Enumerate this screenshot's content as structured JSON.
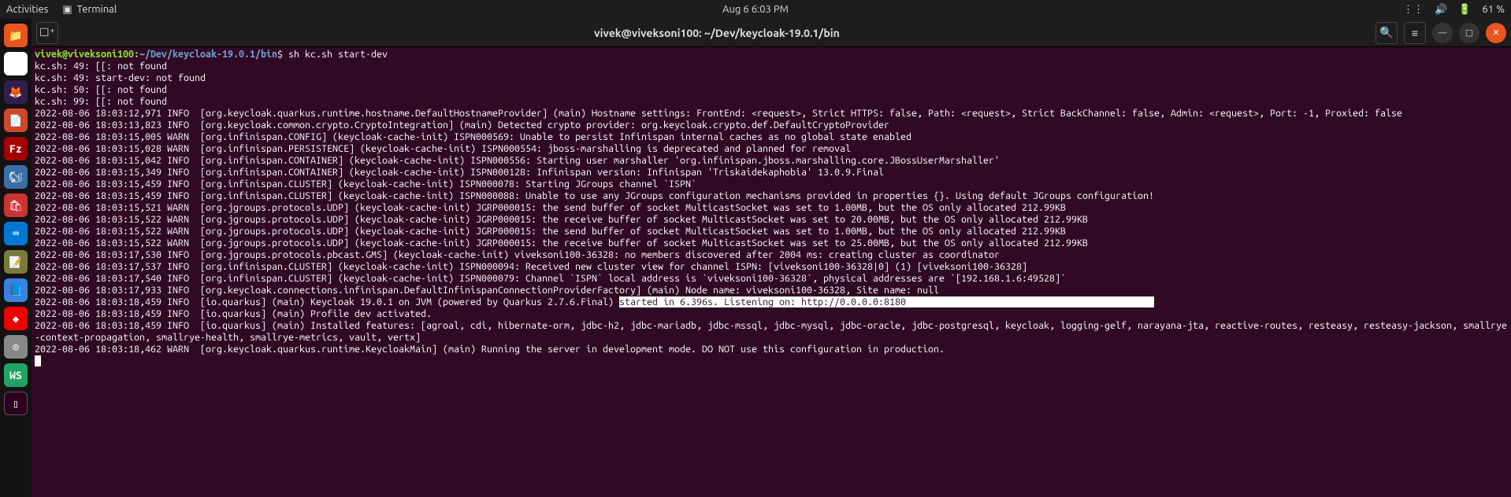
{
  "topbar": {
    "activities": "Activities",
    "app_label": "Terminal",
    "clock": "Aug 6  6:03 PM",
    "battery": "61 %"
  },
  "titlebar": {
    "title": "vivek@viveksoni100: ~/Dev/keycloak-19.0.1/bin"
  },
  "prompt": {
    "user_host": "vivek@viveksoni100:",
    "path": "~/Dev/keycloak-19.0.1/bin",
    "dollar": "$",
    "command": " sh kc.sh start-dev"
  },
  "lines": {
    "l0": "kc.sh: 49: [[: not found",
    "l1": "kc.sh: 49: start-dev: not found",
    "l2": "kc.sh: 50: [[: not found",
    "l3": "kc.sh: 99: [[: not found",
    "l4": "2022-08-06 18:03:12,971 INFO  [org.keycloak.quarkus.runtime.hostname.DefaultHostnameProvider] (main) Hostname settings: FrontEnd: <request>, Strict HTTPS: false, Path: <request>, Strict BackChannel: false, Admin: <request>, Port: -1, Proxied: false",
    "l5": "2022-08-06 18:03:13,823 INFO  [org.keycloak.common.crypto.CryptoIntegration] (main) Detected crypto provider: org.keycloak.crypto.def.DefaultCryptoProvider",
    "l6": "2022-08-06 18:03:15,005 WARN  [org.infinispan.CONFIG] (keycloak-cache-init) ISPN000569: Unable to persist Infinispan internal caches as no global state enabled",
    "l7": "2022-08-06 18:03:15,028 WARN  [org.infinispan.PERSISTENCE] (keycloak-cache-init) ISPN000554: jboss-marshalling is deprecated and planned for removal",
    "l8": "2022-08-06 18:03:15,042 INFO  [org.infinispan.CONTAINER] (keycloak-cache-init) ISPN000556: Starting user marshaller 'org.infinispan.jboss.marshalling.core.JBossUserMarshaller'",
    "l9": "2022-08-06 18:03:15,349 INFO  [org.infinispan.CONTAINER] (keycloak-cache-init) ISPN000128: Infinispan version: Infinispan 'Triskaidekaphobia' 13.0.9.Final",
    "l10": "2022-08-06 18:03:15,459 INFO  [org.infinispan.CLUSTER] (keycloak-cache-init) ISPN000078: Starting JGroups channel `ISPN`",
    "l11": "2022-08-06 18:03:15,459 INFO  [org.infinispan.CLUSTER] (keycloak-cache-init) ISPN000088: Unable to use any JGroups configuration mechanisms provided in properties {}. Using default JGroups configuration!",
    "l12": "2022-08-06 18:03:15,521 WARN  [org.jgroups.protocols.UDP] (keycloak-cache-init) JGRP000015: the send buffer of socket MulticastSocket was set to 1.00MB, but the OS only allocated 212.99KB",
    "l13": "2022-08-06 18:03:15,522 WARN  [org.jgroups.protocols.UDP] (keycloak-cache-init) JGRP000015: the receive buffer of socket MulticastSocket was set to 20.00MB, but the OS only allocated 212.99KB",
    "l14": "2022-08-06 18:03:15,522 WARN  [org.jgroups.protocols.UDP] (keycloak-cache-init) JGRP000015: the send buffer of socket MulticastSocket was set to 1.00MB, but the OS only allocated 212.99KB",
    "l15": "2022-08-06 18:03:15,522 WARN  [org.jgroups.protocols.UDP] (keycloak-cache-init) JGRP000015: the receive buffer of socket MulticastSocket was set to 25.00MB, but the OS only allocated 212.99KB",
    "l16": "2022-08-06 18:03:17,530 INFO  [org.jgroups.protocols.pbcast.GMS] (keycloak-cache-init) viveksoni100-36328: no members discovered after 2004 ms: creating cluster as coordinator",
    "l17": "2022-08-06 18:03:17,537 INFO  [org.infinispan.CLUSTER] (keycloak-cache-init) ISPN000094: Received new cluster view for channel ISPN: [viveksoni100-36328|0] (1) [viveksoni100-36328]",
    "l18": "2022-08-06 18:03:17,540 INFO  [org.infinispan.CLUSTER] (keycloak-cache-init) ISPN000079: Channel `ISPN` local address is `viveksoni100-36328`, physical addresses are `[192.168.1.6:49528]`",
    "l19": "2022-08-06 18:03:17,933 INFO  [org.keycloak.connections.infinispan.DefaultInfinispanConnectionProviderFactory] (main) Node name: viveksoni100-36328, Site name: null",
    "l20a": "2022-08-06 18:03:18,459 INFO  [io.quarkus] (main) Keycloak 19.0.1 on JVM (powered by Quarkus 2.7.6.Final) ",
    "l20b": "started in 6.396s. Listening on: http://0.0.0.0:8180",
    "l21": "2022-08-06 18:03:18,459 INFO  [io.quarkus] (main) Profile dev activated. ",
    "l22": "2022-08-06 18:03:18,459 INFO  [io.quarkus] (main) Installed features: [agroal, cdi, hibernate-orm, jdbc-h2, jdbc-mariadb, jdbc-mssql, jdbc-mysql, jdbc-oracle, jdbc-postgresql, keycloak, logging-gelf, narayana-jta, reactive-routes, resteasy, resteasy-jackson, smallrye-context-propagation, smallrye-health, smallrye-metrics, vault, vertx]",
    "l23": "2022-08-06 18:03:18,462 WARN  [org.keycloak.quarkus.runtime.KeycloakMain] (main) Running the server in development mode. DO NOT use this configuration in production."
  },
  "dock": {
    "fz": "Fz",
    "ws": "WS"
  }
}
